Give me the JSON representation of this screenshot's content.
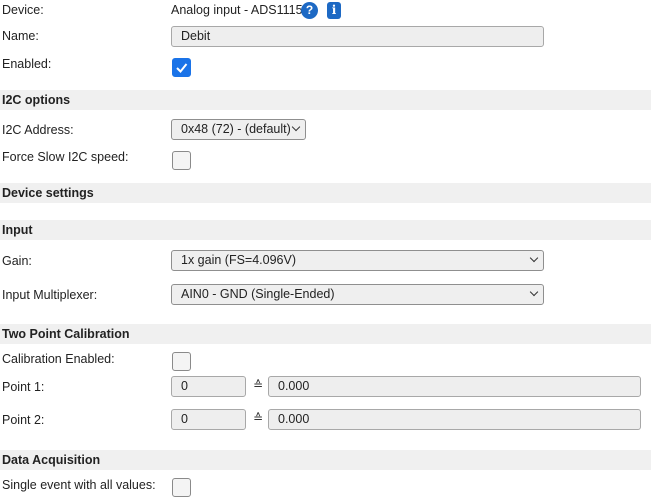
{
  "device": {
    "label": "Device:",
    "value": "Analog input - ADS1115",
    "help_icon": "question-icon",
    "info_icon": "info-icon"
  },
  "name": {
    "label": "Name:",
    "value": "Debit"
  },
  "enabled": {
    "label": "Enabled:",
    "checked": true
  },
  "i2c_section": {
    "title": "I2C options"
  },
  "i2c_address": {
    "label": "I2C Address:",
    "value": "0x48 (72) - (default)"
  },
  "force_slow": {
    "label": "Force Slow I2C speed:",
    "checked": false
  },
  "device_settings": {
    "title": "Device settings"
  },
  "input_section": {
    "title": "Input"
  },
  "gain": {
    "label": "Gain:",
    "value": "1x gain (FS=4.096V)"
  },
  "multiplexer": {
    "label": "Input Multiplexer:",
    "value": "AIN0 - GND (Single-Ended)"
  },
  "calibration_section": {
    "title": "Two Point Calibration"
  },
  "calibration_enabled": {
    "label": "Calibration Enabled:",
    "checked": false
  },
  "point1": {
    "label": "Point 1:",
    "raw": "0",
    "symbol": "≙",
    "value": "0.000"
  },
  "point2": {
    "label": "Point 2:",
    "raw": "0",
    "symbol": "≙",
    "value": "0.000"
  },
  "acquisition_section": {
    "title": "Data Acquisition"
  },
  "single_event": {
    "label": "Single event with all values:",
    "checked": false
  },
  "colors": {
    "accent": "#1a73e8",
    "section_bg": "#f0f0f0",
    "field_bg": "#eeeeee"
  }
}
